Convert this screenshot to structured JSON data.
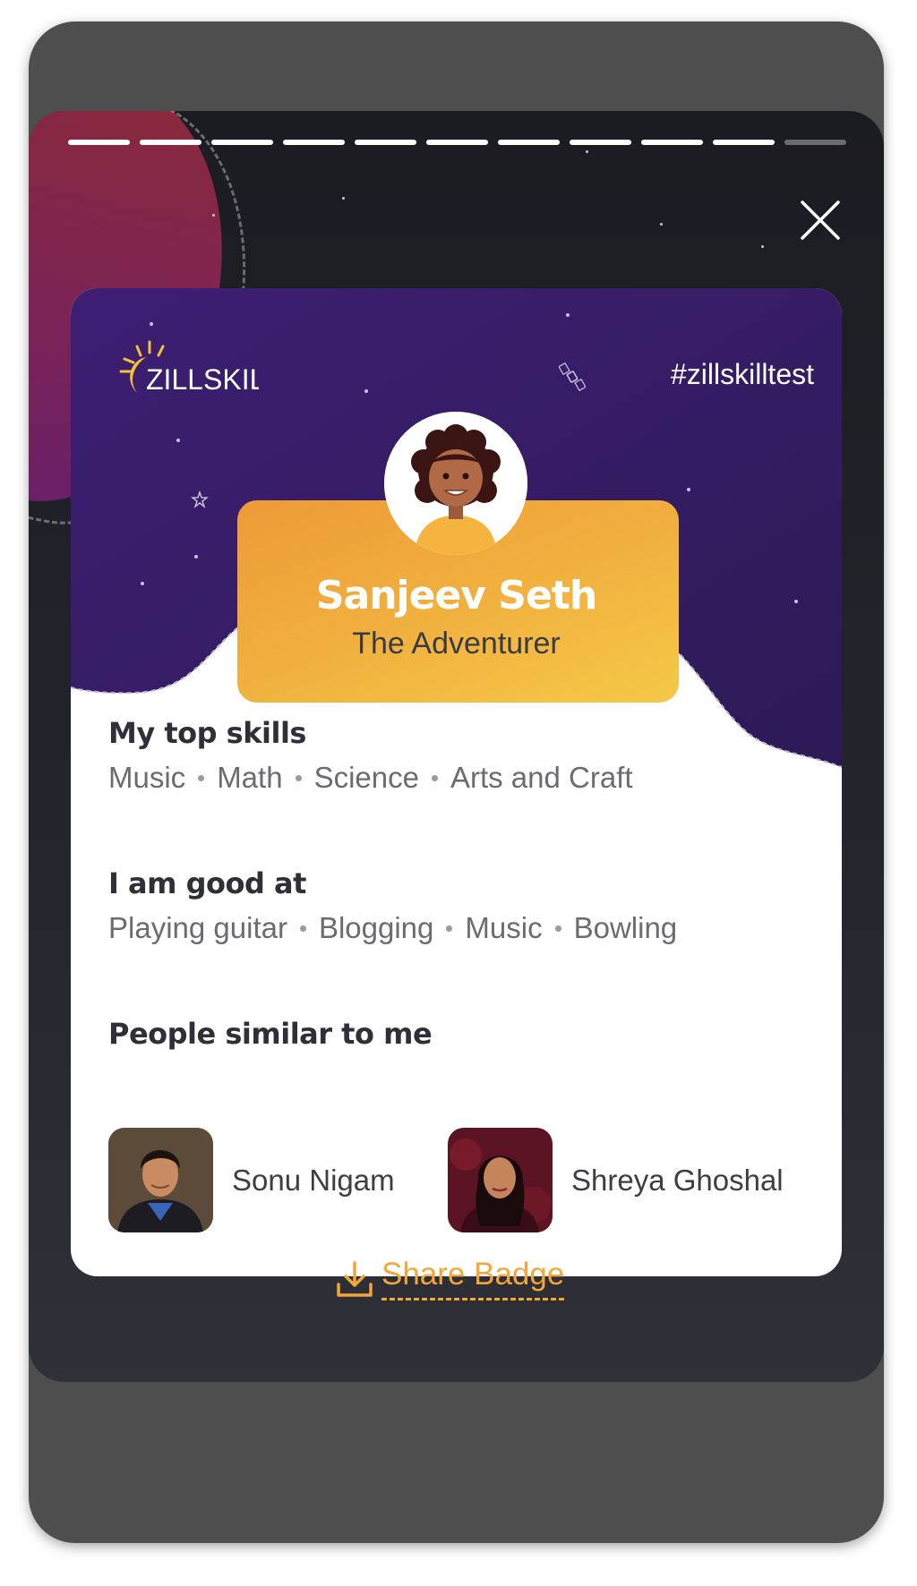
{
  "brand": {
    "name": "ZILLSKILL",
    "accent": "#f3a73b",
    "purple": "#3b1f70"
  },
  "hashtag": "#zillskilltest",
  "progress": {
    "total_segments": 11,
    "completed_segments": 10
  },
  "profile": {
    "name": "Sanjeev Seth",
    "title": "The Adventurer"
  },
  "skills": {
    "heading": "My top skills",
    "items": [
      "Music",
      "Math",
      "Science",
      "Arts and Craft"
    ]
  },
  "good_at": {
    "heading": "I am good at",
    "items": [
      "Playing guitar",
      "Blogging",
      "Music",
      "Bowling"
    ]
  },
  "similar": {
    "heading": "People similar to me",
    "people": [
      {
        "name": "Sonu Nigam"
      },
      {
        "name": "Shreya Ghoshal"
      }
    ]
  },
  "share": {
    "label": "Share Badge"
  },
  "icons": {
    "close": "close-icon",
    "share": "download-icon",
    "satellite": "satellite-icon"
  }
}
